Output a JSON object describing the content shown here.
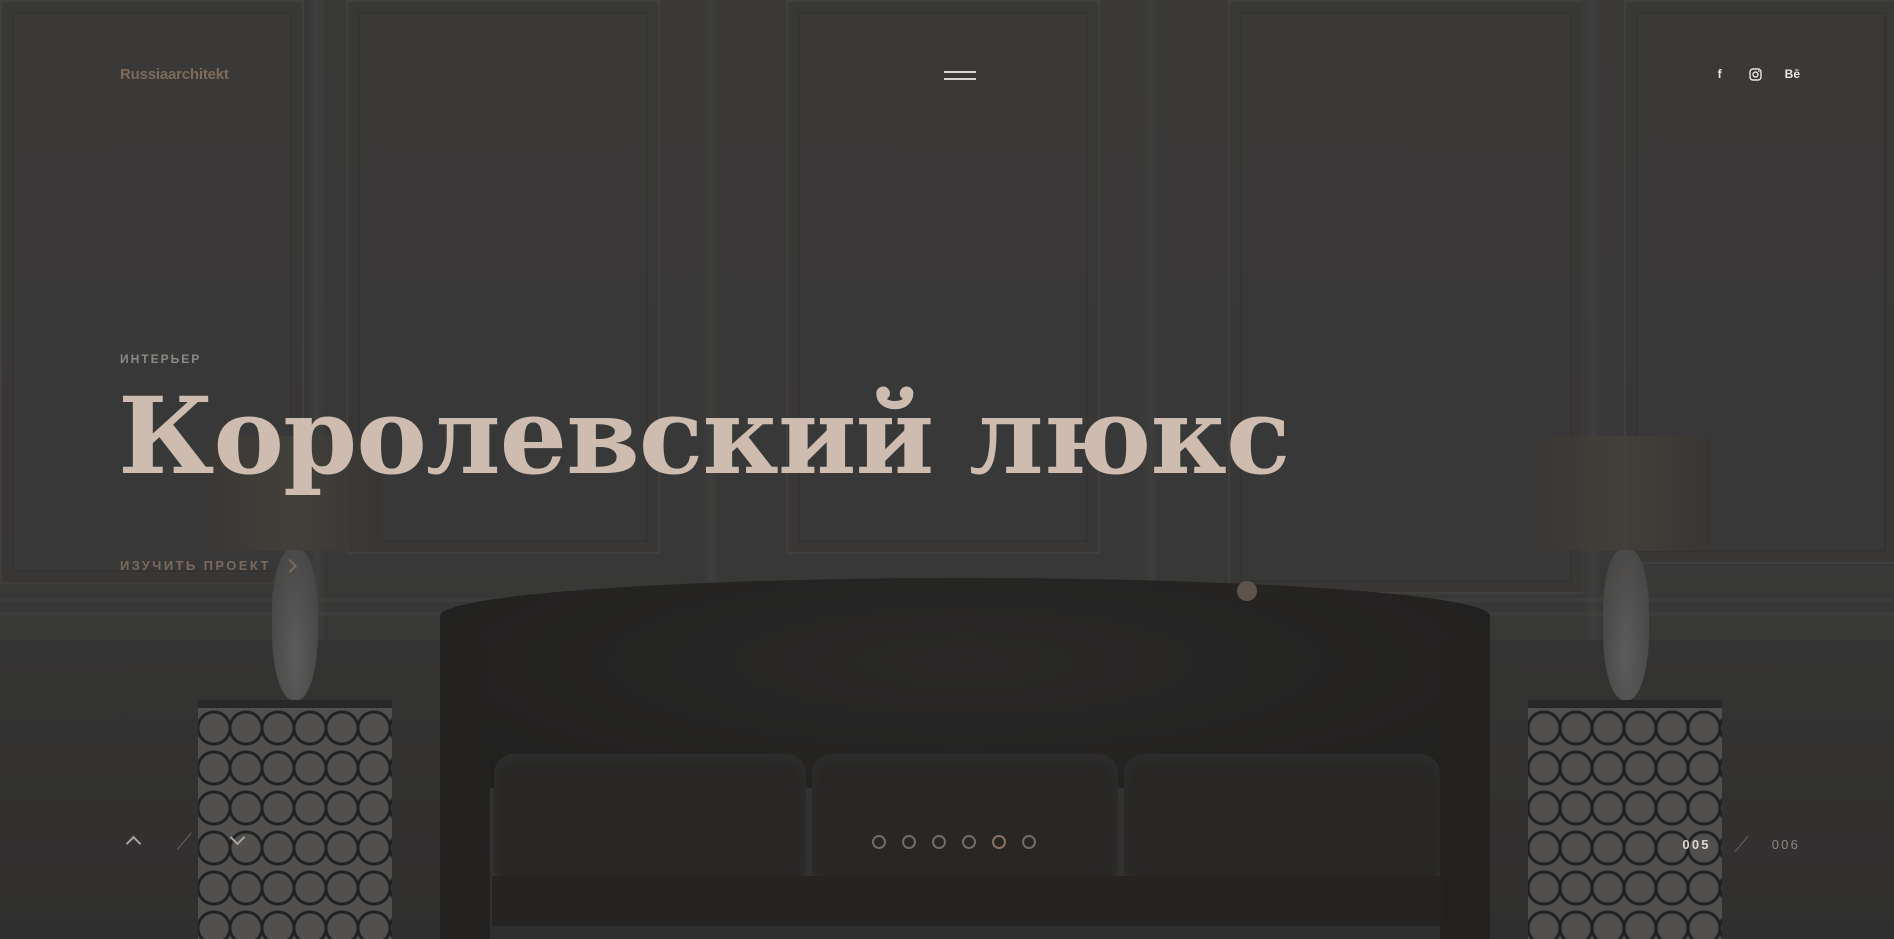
{
  "brand": {
    "logo": "Russiaarchitekt",
    "accent": "#7d6a58"
  },
  "header": {
    "menu_icon": "hamburger-icon",
    "socials": [
      {
        "name": "facebook-icon",
        "glyph": "f"
      },
      {
        "name": "instagram-icon",
        "glyph": "◎"
      },
      {
        "name": "behance-icon",
        "glyph": "Bē"
      }
    ]
  },
  "hero": {
    "category": "ИНТЕРЬЕР",
    "title": "Королевский люкс",
    "cta": "ИЗУЧИТЬ ПРОЕКТ",
    "title_color": "#cdbcaf"
  },
  "slider": {
    "dots_total": 6,
    "active_dot": 5,
    "current": "005",
    "total": "006",
    "prev_icon": "chevron-up-icon",
    "next_icon": "chevron-down-icon"
  }
}
